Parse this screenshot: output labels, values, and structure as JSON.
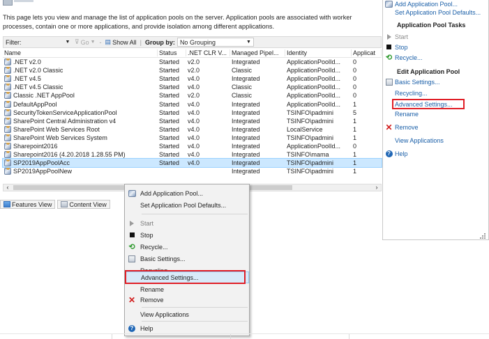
{
  "description": {
    "line1": "This page lets you view and manage the list of application pools on the server. Application pools are associated with worker",
    "line2": "processes, contain one or more applications, and provide isolation among different applications."
  },
  "filterbar": {
    "filter_label": "Filter:",
    "go_label": "Go",
    "show_all_label": "Show All",
    "group_by_label": "Group by:",
    "group_by_value": "No Grouping"
  },
  "columns": [
    "Name",
    "Status",
    ".NET CLR V...",
    "Managed Pipel...",
    "Identity",
    "Applicat"
  ],
  "rows": [
    {
      "name": ".NET v2.0",
      "status": "Started",
      "clr": "v2.0",
      "pipeline": "Integrated",
      "identity": "ApplicationPoolId...",
      "apps": "0"
    },
    {
      "name": ".NET v2.0 Classic",
      "status": "Started",
      "clr": "v2.0",
      "pipeline": "Classic",
      "identity": "ApplicationPoolId...",
      "apps": "0"
    },
    {
      "name": ".NET v4.5",
      "status": "Started",
      "clr": "v4.0",
      "pipeline": "Integrated",
      "identity": "ApplicationPoolId...",
      "apps": "0"
    },
    {
      "name": ".NET v4.5 Classic",
      "status": "Started",
      "clr": "v4.0",
      "pipeline": "Classic",
      "identity": "ApplicationPoolId...",
      "apps": "0"
    },
    {
      "name": "Classic .NET AppPool",
      "status": "Started",
      "clr": "v2.0",
      "pipeline": "Classic",
      "identity": "ApplicationPoolId...",
      "apps": "0"
    },
    {
      "name": "DefaultAppPool",
      "status": "Started",
      "clr": "v4.0",
      "pipeline": "Integrated",
      "identity": "ApplicationPoolId...",
      "apps": "1"
    },
    {
      "name": "SecurityTokenServiceApplicationPool",
      "status": "Started",
      "clr": "v4.0",
      "pipeline": "Integrated",
      "identity": "TSINFO\\padmini",
      "apps": "5"
    },
    {
      "name": "SharePoint Central Administration v4",
      "status": "Started",
      "clr": "v4.0",
      "pipeline": "Integrated",
      "identity": "TSINFO\\padmini",
      "apps": "1"
    },
    {
      "name": "SharePoint Web Services Root",
      "status": "Started",
      "clr": "v4.0",
      "pipeline": "Integrated",
      "identity": "LocalService",
      "apps": "1"
    },
    {
      "name": "SharePoint Web Services System",
      "status": "Started",
      "clr": "v4.0",
      "pipeline": "Integrated",
      "identity": "TSINFO\\padmini",
      "apps": "1"
    },
    {
      "name": "Sharepoint2016",
      "status": "Started",
      "clr": "v4.0",
      "pipeline": "Integrated",
      "identity": "ApplicationPoolId...",
      "apps": "0"
    },
    {
      "name": "Sharepoint2016 (4.20.2018 1.28.55 PM)",
      "status": "Started",
      "clr": "v4.0",
      "pipeline": "Integrated",
      "identity": "TSINFO\\mama",
      "apps": "1"
    },
    {
      "name": "SP2019AppPoolAcc",
      "status": "Started",
      "clr": "v4.0",
      "pipeline": "Integrated",
      "identity": "TSINFO\\padmini",
      "apps": "1",
      "selected": true
    },
    {
      "name": "SP2019AppPoolNew",
      "status": "",
      "clr": "",
      "pipeline": "Integrated",
      "identity": "TSINFO\\padmini",
      "apps": "1"
    }
  ],
  "view_tabs": {
    "features": "Features View",
    "content": "Content View"
  },
  "actions_panel": {
    "add_pool": "Add Application Pool...",
    "set_defaults": "Set Application Pool Defaults...",
    "tasks_heading": "Application Pool Tasks",
    "start": "Start",
    "stop": "Stop",
    "recycle": "Recycle...",
    "edit_heading": "Edit Application Pool",
    "basic_settings": "Basic Settings...",
    "recycling": "Recycling...",
    "advanced_settings": "Advanced Settings...",
    "rename": "Rename",
    "remove": "Remove",
    "view_applications": "View Applications",
    "help": "Help"
  },
  "context_menu": {
    "add_pool": "Add Application Pool...",
    "set_defaults": "Set Application Pool Defaults...",
    "start": "Start",
    "stop": "Stop",
    "recycle": "Recycle...",
    "basic_settings": "Basic Settings...",
    "recycling": "Recycling...",
    "advanced_settings": "Advanced Settings...",
    "rename": "Rename",
    "remove": "Remove",
    "view_applications": "View Applications",
    "help": "Help"
  },
  "colors": {
    "link": "#1a5fa8",
    "highlight_box": "#e01e26",
    "selection": "#cce8ff"
  }
}
